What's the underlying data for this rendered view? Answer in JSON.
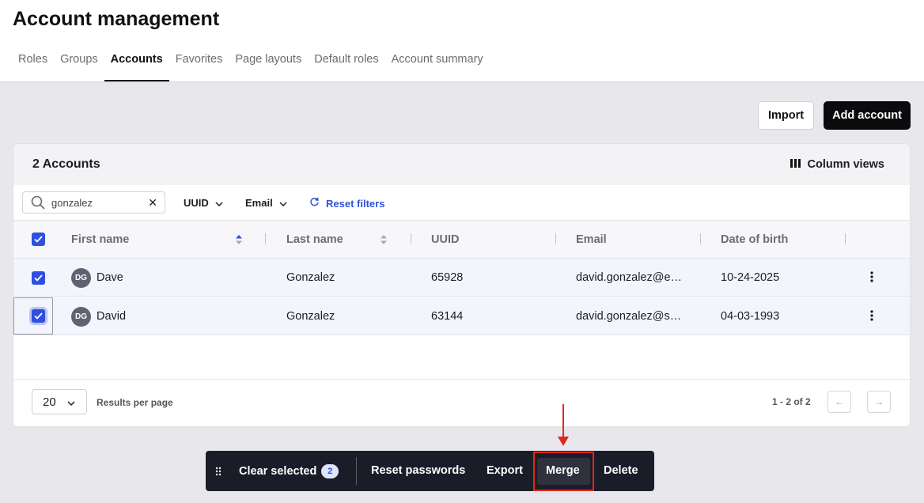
{
  "page": {
    "title": "Account management"
  },
  "tabs": [
    {
      "label": "Roles"
    },
    {
      "label": "Groups"
    },
    {
      "label": "Accounts",
      "active": true
    },
    {
      "label": "Favorites"
    },
    {
      "label": "Page layouts"
    },
    {
      "label": "Default roles"
    },
    {
      "label": "Account summary"
    }
  ],
  "toolbar": {
    "import_label": "Import",
    "add_label": "Add account"
  },
  "card": {
    "title": "2 Accounts",
    "column_views_label": "Column views",
    "column_views_icon": "columns-icon"
  },
  "filters": {
    "search_value": "gonzalez",
    "search_placeholder": "Search",
    "clear_glyph": "✕",
    "uuid_label": "UUID",
    "email_label": "Email",
    "reset_label": "Reset filters"
  },
  "table": {
    "columns": [
      "First name",
      "Last name",
      "UUID",
      "Email",
      "Date of birth"
    ],
    "sorted_column": "First name",
    "rows": [
      {
        "initials": "DG",
        "first": "Dave",
        "last": "Gonzalez",
        "uuid": "65928",
        "email": "david.gonzalez@e…",
        "dob": "10-24-2025",
        "selected": true
      },
      {
        "initials": "DG",
        "first": "David",
        "last": "Gonzalez",
        "uuid": "63144",
        "email": "david.gonzalez@s…",
        "dob": "04-03-1993",
        "selected": true
      }
    ]
  },
  "pagination": {
    "per_page": "20",
    "per_page_label": "Results per page",
    "range": "1 - 2 of 2",
    "prev_glyph": "←",
    "next_glyph": "→"
  },
  "action_bar": {
    "clear_label": "Clear selected",
    "selected_count": "2",
    "reset_passwords_label": "Reset passwords",
    "export_label": "Export",
    "merge_label": "Merge",
    "delete_label": "Delete"
  },
  "colors": {
    "accent": "#2f4fe0",
    "annotation": "#e0281e",
    "action_bar": "#1a1d27"
  }
}
